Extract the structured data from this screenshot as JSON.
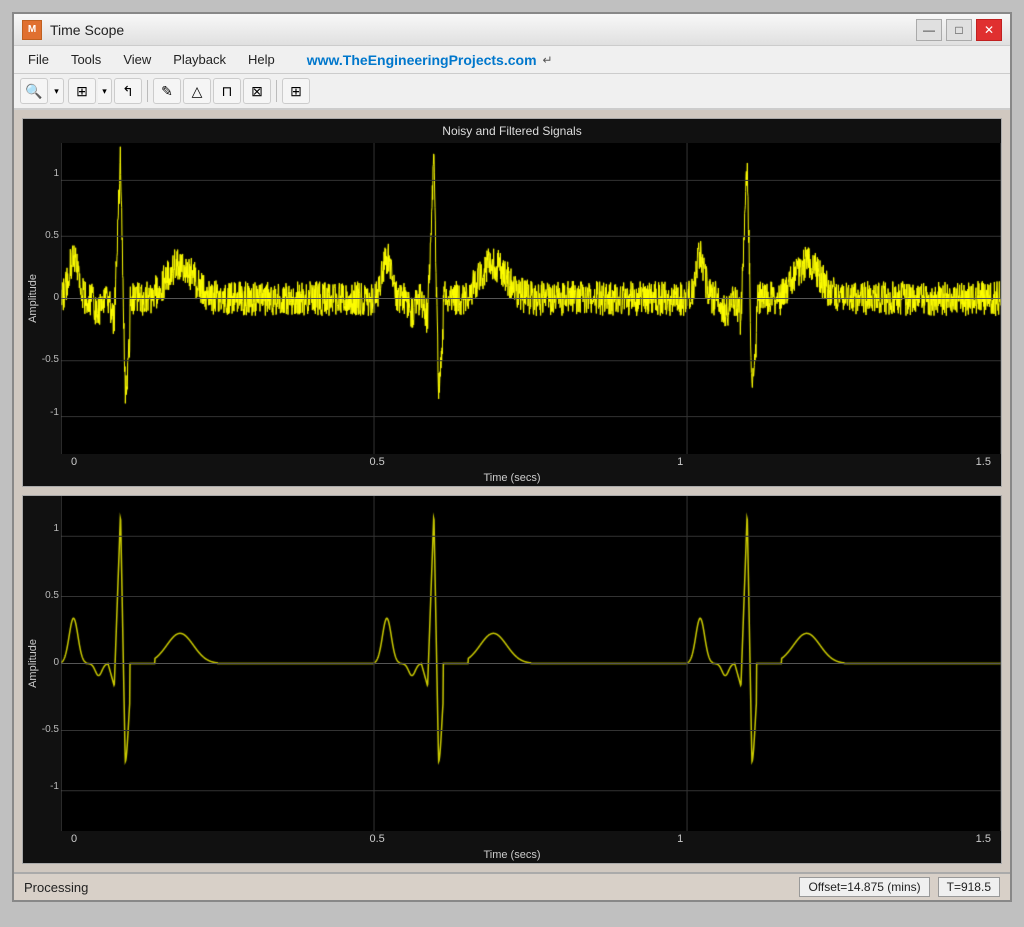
{
  "window": {
    "title": "Time Scope",
    "icon_label": "M"
  },
  "window_controls": {
    "minimize_label": "—",
    "maximize_label": "□",
    "close_label": "✕"
  },
  "menu": {
    "items": [
      {
        "label": "File"
      },
      {
        "label": "Tools"
      },
      {
        "label": "View"
      },
      {
        "label": "Playback"
      },
      {
        "label": "Help"
      }
    ],
    "url": "www.TheEngineeringProjects.com"
  },
  "toolbar": {
    "buttons": [
      {
        "icon": "🔍",
        "name": "zoom-in"
      },
      {
        "icon": "▼",
        "name": "zoom-in-dropdown"
      },
      {
        "icon": "⊞",
        "name": "zoom-fit"
      },
      {
        "icon": "▼",
        "name": "zoom-fit-dropdown"
      },
      {
        "icon": "↰",
        "name": "undo-zoom"
      },
      {
        "icon": "✏",
        "name": "edit"
      },
      {
        "icon": "△",
        "name": "signal1"
      },
      {
        "icon": "⊓",
        "name": "signal2"
      },
      {
        "icon": "⊠",
        "name": "signal3"
      },
      {
        "icon": "⊞",
        "name": "layout"
      }
    ]
  },
  "plots": [
    {
      "title": "Noisy and Filtered Signals",
      "y_axis_label": "Amplitude",
      "x_axis_label": "Time (secs)",
      "y_ticks": [
        "1",
        "0.5",
        "0",
        "-0.5",
        "-1"
      ],
      "x_ticks": [
        "0",
        "0.5",
        "1",
        "1.5"
      ],
      "type": "noisy"
    },
    {
      "title": "",
      "y_axis_label": "Amplitude",
      "x_axis_label": "Time (secs)",
      "y_ticks": [
        "1",
        "0.5",
        "0",
        "-0.5",
        "-1"
      ],
      "x_ticks": [
        "0",
        "0.5",
        "1",
        "1.5"
      ],
      "type": "filtered"
    }
  ],
  "status": {
    "left": "Processing",
    "offset": "Offset=14.875 (mins)",
    "time": "T=918.5"
  },
  "colors": {
    "signal_noisy": "#ffff00",
    "signal_filtered": "#cccc00",
    "background": "#000000",
    "grid": "#333333"
  }
}
